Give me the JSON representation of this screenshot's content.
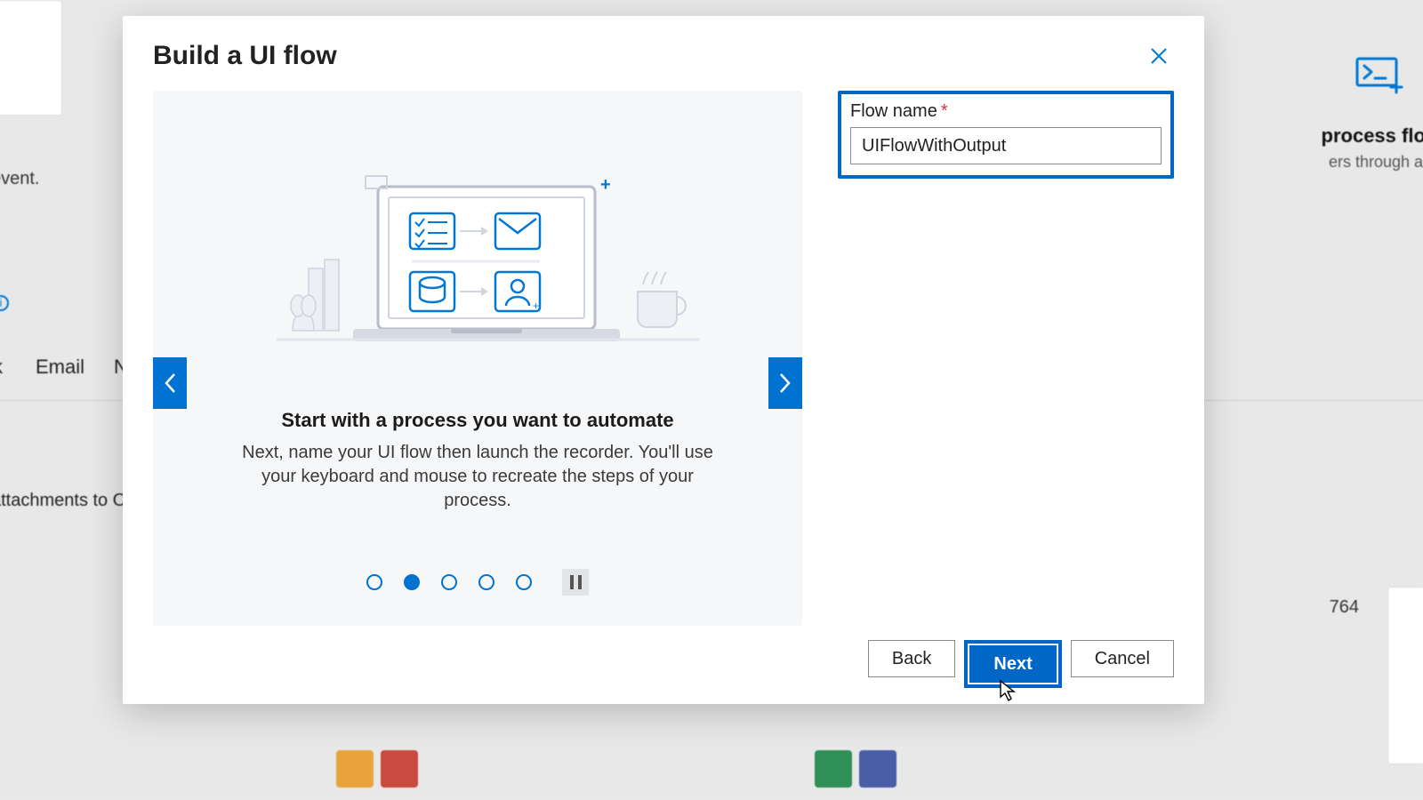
{
  "modal": {
    "title": "Build a UI flow",
    "carousel": {
      "slide_title": "Start with a process you want to automate",
      "slide_desc": "Next, name your UI flow then launch the recorder. You'll use your keyboard and mouse to recreate the steps of your process.",
      "active_index": 1,
      "total_dots": 5
    },
    "form": {
      "flow_name_label": "Flow name",
      "flow_name_value": "UIFlowWithOutput"
    },
    "buttons": {
      "back": "Back",
      "next": "Next",
      "cancel": "Cancel"
    }
  },
  "backdrop": {
    "event": "event.",
    "k": "k",
    "email": "Email",
    "n": "N",
    "attachments": "attachments to O",
    "right_title": "process flow",
    "right_sub": "ers through a m",
    "num": "764"
  }
}
